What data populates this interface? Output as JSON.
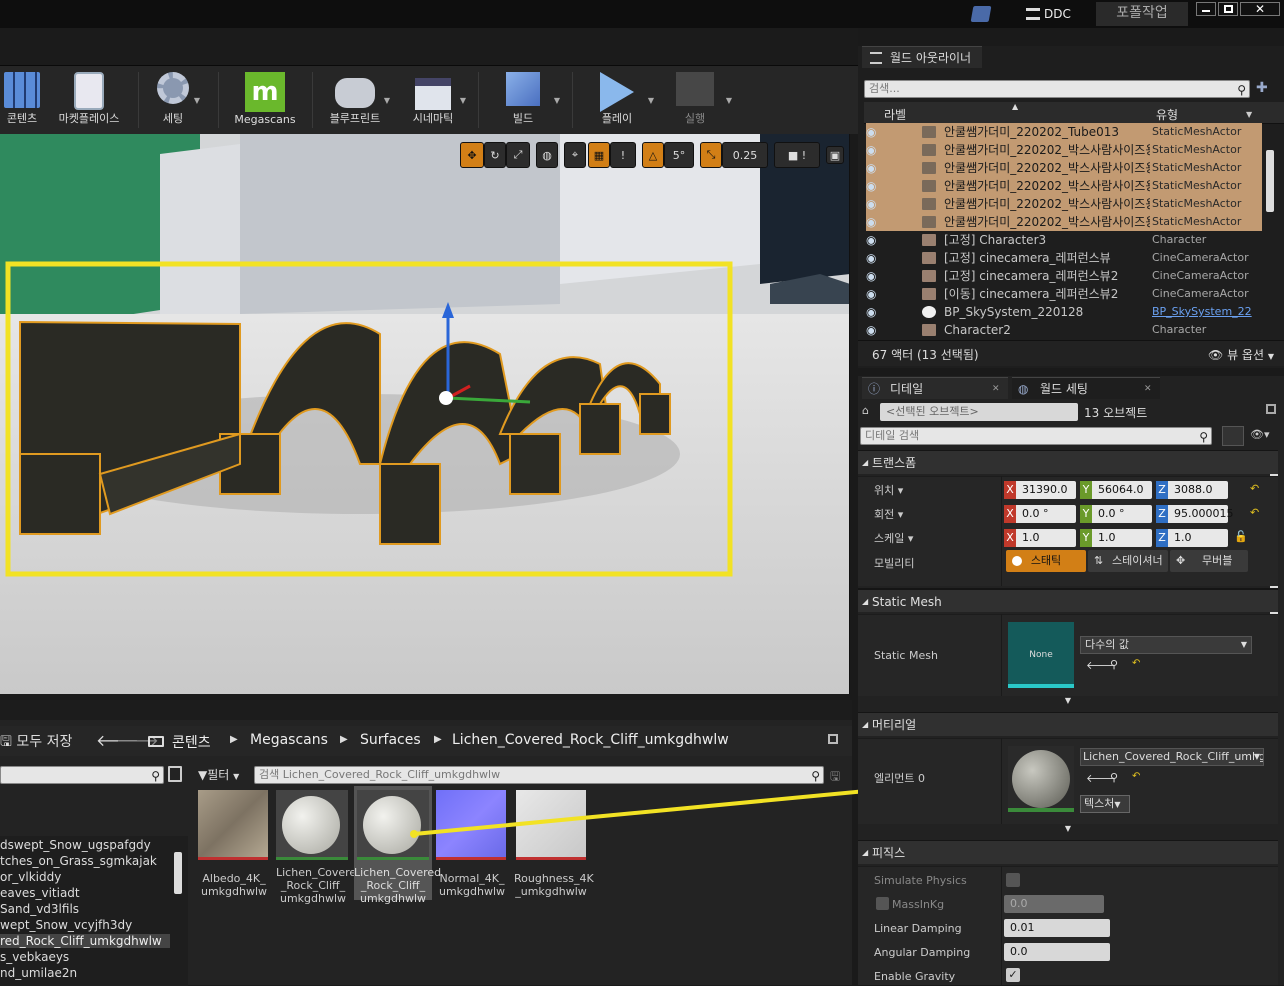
{
  "titlebar": {
    "ddc": "DDC",
    "project_tab": "포폴작업"
  },
  "toolbar": {
    "items": [
      {
        "label": "콘텐츠"
      },
      {
        "label": "마켓플레이스"
      },
      {
        "label": "세팅"
      },
      {
        "label": "Megascans"
      },
      {
        "label": "블루프린트"
      },
      {
        "label": "시네마틱"
      },
      {
        "label": "빌드"
      },
      {
        "label": "플레이"
      },
      {
        "label": "실행"
      }
    ]
  },
  "viewport": {
    "rotation_snap": "5°",
    "scale_snap": "0.25",
    "cam_speed": "!"
  },
  "content_browser": {
    "save_all": "모두 저장",
    "breadcrumb": [
      "콘텐츠",
      "Megascans",
      "Surfaces",
      "Lichen_Covered_Rock_Cliff_umkgdhwlw"
    ],
    "filter": "필터",
    "search_placeholder": "검색 Lichen_Covered_Rock_Cliff_umkgdhwlw",
    "folders": [
      "dswept_Snow_ugspafgdy",
      "tches_on_Grass_sgmkajak",
      "or_vlkiddy",
      "eaves_vitiadt",
      "Sand_vd3lfils",
      "wept_Snow_vcyjfh3dy",
      "red_Rock_Cliff_umkgdhwlw",
      "s_vebkaeys",
      "nd_umilae2n"
    ],
    "assets": [
      {
        "line1": "Albedo_4K_",
        "line2": "umkgdhwlw",
        "line3": ""
      },
      {
        "line1": "Lichen_Covered",
        "line2": "_Rock_Cliff_",
        "line3": "umkgdhwlw"
      },
      {
        "line1": "Lichen_Covered",
        "line2": "_Rock_Cliff_",
        "line3": "umkgdhwlw"
      },
      {
        "line1": "Normal_4K_",
        "line2": "umkgdhwlw",
        "line3": ""
      },
      {
        "line1": "Roughness_4K",
        "line2": "_umkgdhwlw",
        "line3": ""
      }
    ]
  },
  "outliner": {
    "tab": "월드 아웃라이너",
    "search_placeholder": "검색...",
    "col_label": "라벨",
    "col_type": "유형",
    "rows": [
      {
        "label": "안쿨쌤가더미_220202_Tube013",
        "type": "StaticMeshActor"
      },
      {
        "label": "안쿨쌤가더미_220202_박스사람사이즈용",
        "type": "StaticMeshActor"
      },
      {
        "label": "안쿨쌤가더미_220202_박스사람사이즈용",
        "type": "StaticMeshActor"
      },
      {
        "label": "안쿨쌤가더미_220202_박스사람사이즈용",
        "type": "StaticMeshActor"
      },
      {
        "label": "안쿨쌤가더미_220202_박스사람사이즈용",
        "type": "StaticMeshActor"
      },
      {
        "label": "안쿨쌤가더미_220202_박스사람사이즈용",
        "type": "StaticMeshActor"
      },
      {
        "label": "[고정] Character3",
        "type": "Character"
      },
      {
        "label": "[고정] cinecamera_레퍼런스뷰",
        "type": "CineCameraActor"
      },
      {
        "label": "[고정] cinecamera_레퍼런스뷰2",
        "type": "CineCameraActor"
      },
      {
        "label": "[이동] cinecamera_레퍼런스뷰2",
        "type": "CineCameraActor"
      },
      {
        "label": "BP_SkySystem_220128",
        "type": "BP_SkySystem_22"
      },
      {
        "label": "Character2",
        "type": "Character"
      }
    ],
    "footer": "67 액터 (13 선택됨)",
    "view_options": "뷰 옵션"
  },
  "details": {
    "tab1": "디테일",
    "tab2": "월드 세팅",
    "selected_placeholder": "<선택된 오브젝트>",
    "object_count": "13 오브젝트",
    "search_placeholder": "디테일 검색",
    "transform": {
      "title": "트랜스폼",
      "location_label": "위치",
      "rotation_label": "회전",
      "scale_label": "스케일",
      "mobility_label": "모빌리티",
      "loc": [
        "31390.0",
        "56064.0",
        "3088.0"
      ],
      "rot": [
        "0.0 °",
        "0.0 °",
        "95.000015"
      ],
      "scale": [
        "1.0",
        "1.0",
        "1.0"
      ],
      "mobility": [
        "스태틱",
        "스테이셔너",
        "무버블"
      ]
    },
    "static_mesh": {
      "title": "Static Mesh",
      "prop_label": "Static Mesh",
      "thumb": "None",
      "value": "다수의 값"
    },
    "materials": {
      "title": "머티리얼",
      "element": "엘리먼트 0",
      "value": "Lichen_Covered_Rock_Cliff_umkg",
      "texture_btn": "텍스처"
    },
    "physics": {
      "title": "피직스",
      "props": [
        {
          "label": "Simulate Physics",
          "value": ""
        },
        {
          "label": "MassInKg",
          "value": "0.0"
        },
        {
          "label": "Linear Damping",
          "value": "0.01"
        },
        {
          "label": "Angular Damping",
          "value": "0.0"
        },
        {
          "label": "Enable Gravity",
          "value": ""
        }
      ]
    }
  },
  "colors": {
    "accent_orange": "#d27f16",
    "selection": "#c29a72",
    "highlight_yellow": "#f2e224",
    "x": "#c0392b",
    "y": "#6a9a2a",
    "z": "#2f6fc4"
  }
}
